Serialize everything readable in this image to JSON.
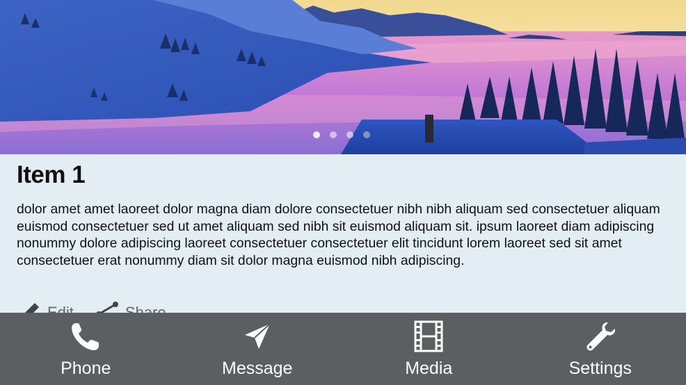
{
  "carousel": {
    "pages": [
      {
        "active": true
      },
      {
        "active": false
      },
      {
        "active": false
      },
      {
        "active": false
      }
    ]
  },
  "item": {
    "title": "Item 1",
    "body": "dolor amet amet laoreet dolor magna diam dolore consectetuer nibh nibh aliquam sed consectetuer aliquam euismod consectetuer sed ut amet aliquam sed nibh sit euismod aliquam sit. ipsum laoreet diam adipiscing nonummy dolore adipiscing laoreet consectetuer consectetuer elit tincidunt lorem laoreet sed sit amet consectetuer erat nonummy diam sit dolor magna euismod nibh adipiscing.",
    "actions": [
      {
        "label": "Edit",
        "icon": "pencil-icon"
      },
      {
        "label": "Share",
        "icon": "share-icon"
      }
    ]
  },
  "tabbar": {
    "tabs": [
      {
        "label": "Phone",
        "icon": "phone-icon"
      },
      {
        "label": "Message",
        "icon": "paper-plane-icon"
      },
      {
        "label": "Media",
        "icon": "film-icon"
      },
      {
        "label": "Settings",
        "icon": "wrench-icon"
      }
    ]
  },
  "colors": {
    "content_background": "#e3eef4",
    "tabbar_background": "#5c5f62",
    "tab_foreground": "#ffffff"
  }
}
